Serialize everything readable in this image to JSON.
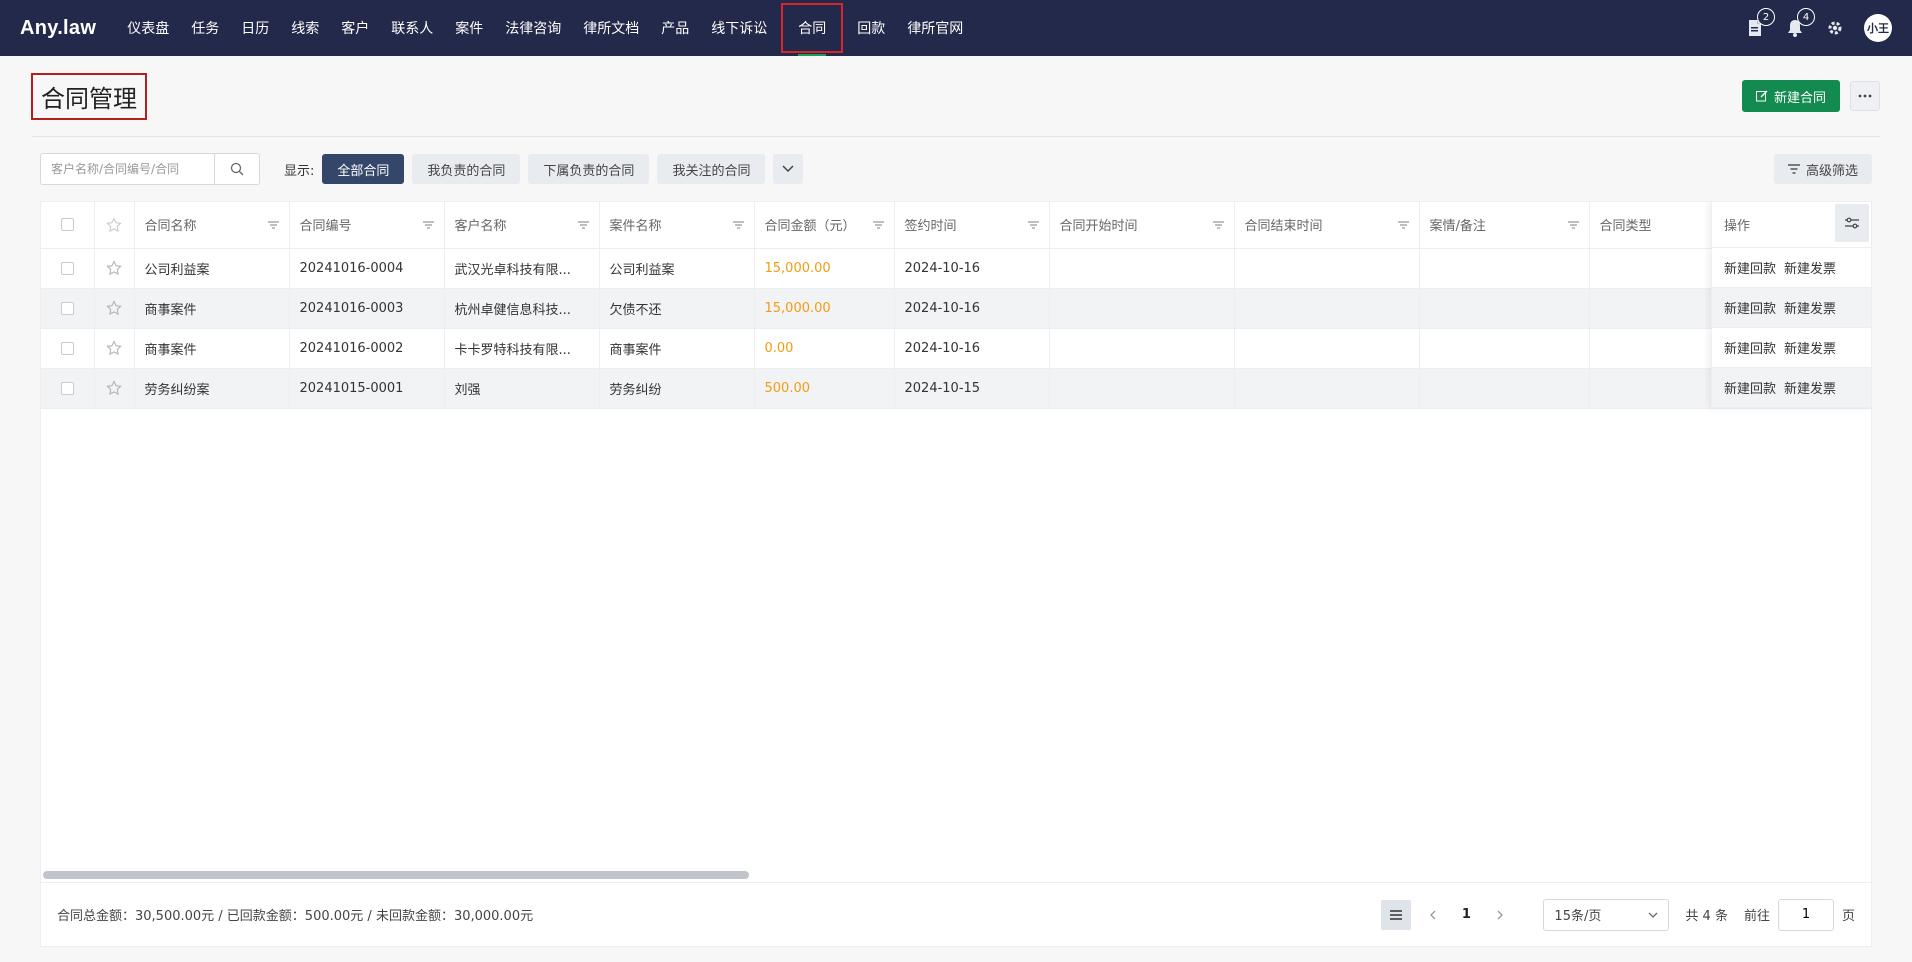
{
  "app": {
    "logo": "Any.law",
    "nav": [
      "仪表盘",
      "任务",
      "日历",
      "线索",
      "客户",
      "联系人",
      "案件",
      "法律咨询",
      "律所文档",
      "产品",
      "线下诉讼",
      "合同",
      "回款",
      "律所官网"
    ],
    "active_nav": "合同",
    "badges": {
      "docs": "2",
      "notifications": "4"
    },
    "avatar": "小王"
  },
  "page": {
    "title": "合同管理",
    "new_button": "新建合同"
  },
  "filters": {
    "search_placeholder": "客户名称/合同编号/合同",
    "show_label": "显示:",
    "segments": [
      "全部合同",
      "我负责的合同",
      "下属负责的合同",
      "我关注的合同"
    ],
    "active_segment": "全部合同",
    "advanced_label": "高级筛选"
  },
  "table": {
    "columns": [
      "合同名称",
      "合同编号",
      "客户名称",
      "案件名称",
      "合同金额（元）",
      "签约时间",
      "合同开始时间",
      "合同结束时间",
      "案情/备注",
      "合同类型"
    ],
    "ops_label": "操作",
    "rows": [
      {
        "name": "公司利益案",
        "code": "20241016-0004",
        "client": "武汉光卓科技有限...",
        "case": "公司利益案",
        "amount": "15,000.00",
        "signed": "2024-10-16",
        "start": "",
        "end": "",
        "note": "",
        "type": ""
      },
      {
        "name": "商事案件",
        "code": "20241016-0003",
        "client": "杭州卓健信息科技...",
        "case": "欠债不还",
        "amount": "15,000.00",
        "signed": "2024-10-16",
        "start": "",
        "end": "",
        "note": "",
        "type": ""
      },
      {
        "name": "商事案件",
        "code": "20241016-0002",
        "client": "卡卡罗特科技有限...",
        "case": "商事案件",
        "amount": "0.00",
        "signed": "2024-10-16",
        "start": "",
        "end": "",
        "note": "",
        "type": ""
      },
      {
        "name": "劳务纠纷案",
        "code": "20241015-0001",
        "client": "刘强",
        "case": "劳务纠纷",
        "amount": "500.00",
        "signed": "2024-10-15",
        "start": "",
        "end": "",
        "note": "",
        "type": ""
      }
    ],
    "op_actions": [
      "新建回款",
      "新建发票"
    ]
  },
  "footer": {
    "summary": "合同总金额：30,500.00元 / 已回款金额：500.00元 / 未回款金额：30,000.00元",
    "current_page": "1",
    "page_size": "15条/页",
    "total": "共 4 条",
    "goto_label": "前往",
    "goto_value": "1",
    "page_unit": "页"
  },
  "colors": {
    "nav_bg": "#23294a",
    "primary": "#138a4f",
    "amount": "#f39c12",
    "highlight": "#d9252a"
  }
}
